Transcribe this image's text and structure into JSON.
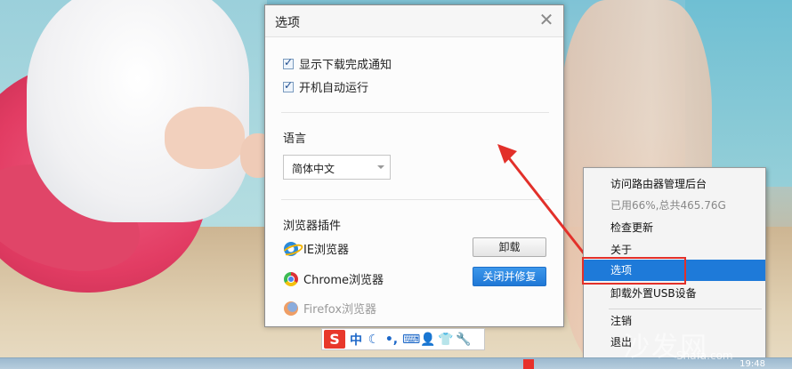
{
  "dialog": {
    "title": "选项",
    "close_glyph": "✕",
    "checkbox_download_notify": "显示下载完成通知",
    "checkbox_autostart": "开机自动运行",
    "language_label": "语言",
    "language_value": "简体中文",
    "plugins_label": "浏览器插件",
    "plugins": [
      {
        "name": "IE浏览器",
        "icon": "ie-icon",
        "action": "卸载"
      },
      {
        "name": "Chrome浏览器",
        "icon": "chrome-icon",
        "action": "关闭并修复"
      },
      {
        "name": "Firefox浏览器",
        "icon": "firefox-icon",
        "action": ""
      }
    ]
  },
  "context_menu": {
    "items": [
      {
        "label": "访问路由器管理后台"
      },
      {
        "label": "已用66%,总共465.76G"
      },
      {
        "label": "检查更新"
      },
      {
        "label": "关于"
      },
      {
        "label": "选项"
      },
      {
        "label": "卸载外置USB设备"
      },
      {
        "label": "注销"
      },
      {
        "label": "退出"
      }
    ],
    "selected": "选项"
  },
  "ime_bar": {
    "logo": "S",
    "items": [
      "中",
      "☾",
      "•,",
      "⌨",
      "👤",
      "👕",
      "🔧"
    ]
  },
  "taskbar": {
    "time": "19:48"
  },
  "watermark": {
    "text": "沙发网",
    "subtext": "Shafa.com"
  },
  "colors": {
    "accent_blue": "#1e7ad9",
    "highlight_red": "#e2302a"
  }
}
